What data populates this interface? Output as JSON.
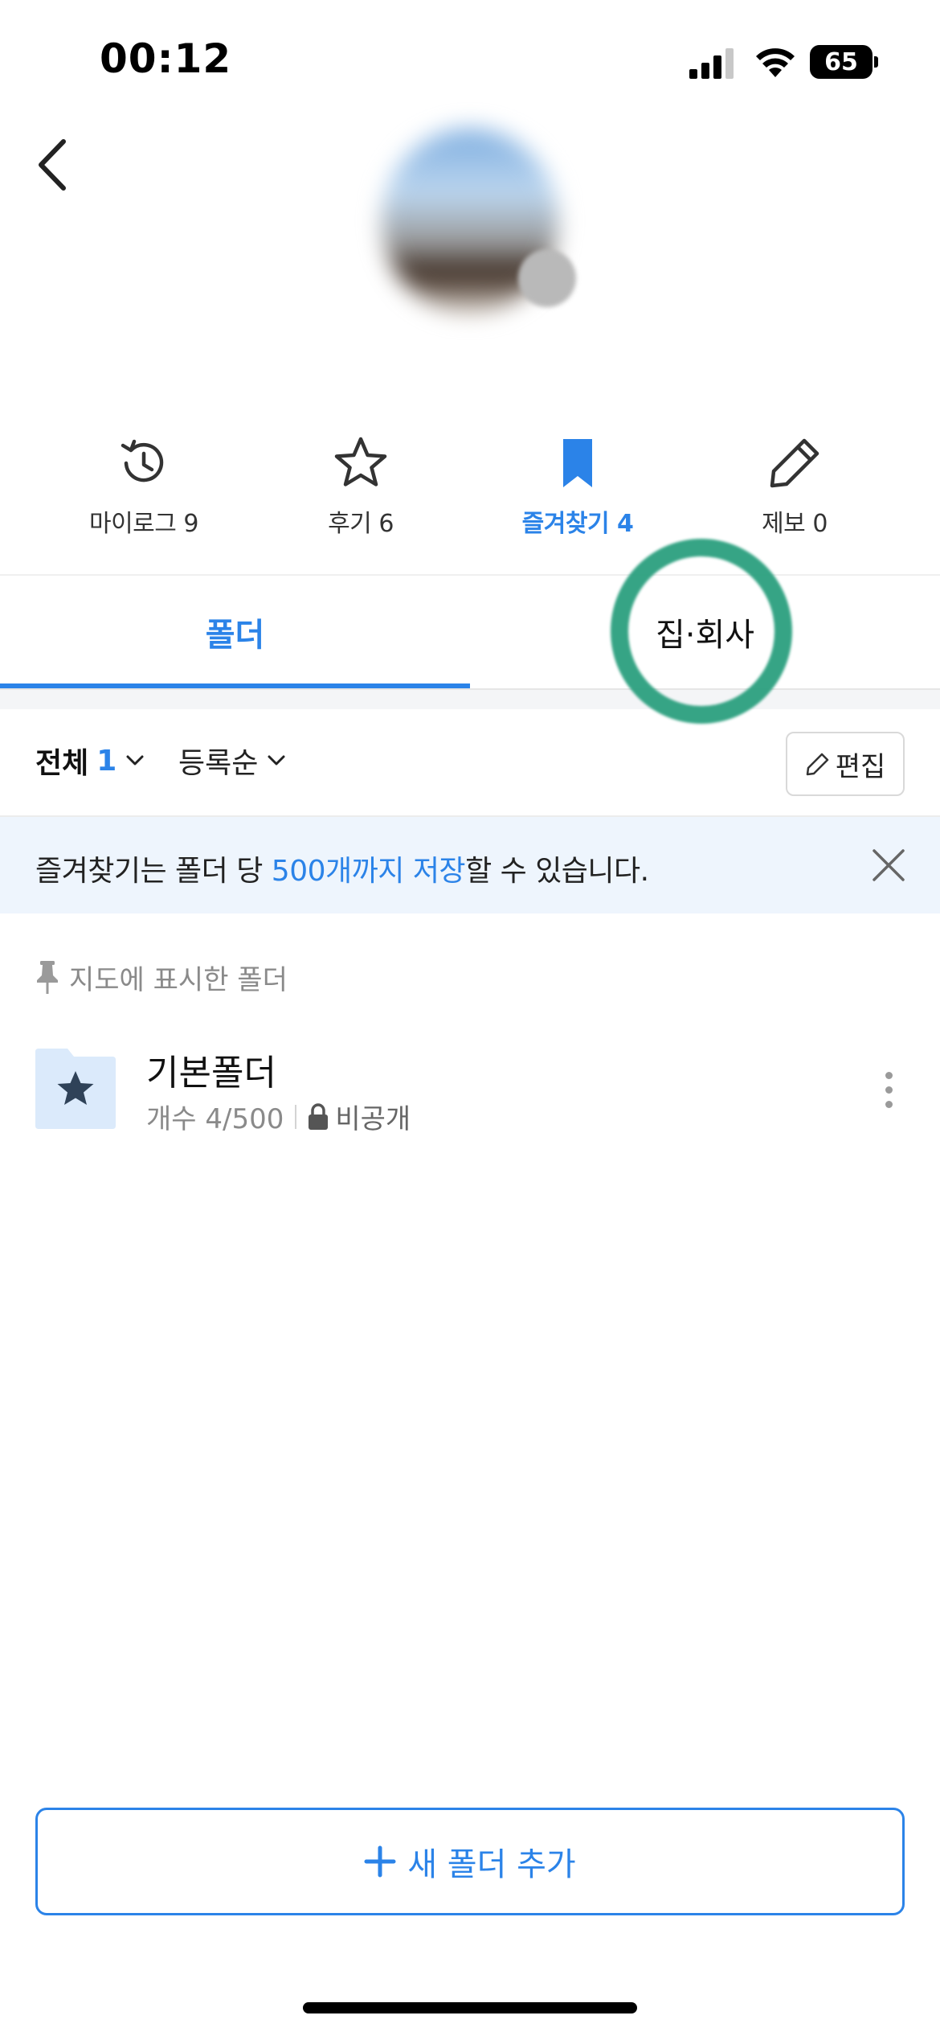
{
  "status_bar": {
    "time": "00:12",
    "battery": "65",
    "icons": [
      "signal-icon",
      "wifi-icon",
      "battery-icon"
    ]
  },
  "header": {
    "back_icon": "chevron-left-icon",
    "avatar": "blurred-profile-avatar"
  },
  "stats": [
    {
      "icon": "history-icon",
      "label": "마이로그 9"
    },
    {
      "icon": "star-icon",
      "label": "후기 6"
    },
    {
      "icon": "bookmark-icon",
      "label": "즐겨찾기 4",
      "active": true
    },
    {
      "icon": "pencil-icon",
      "label": "제보 0"
    }
  ],
  "tabs": [
    {
      "label": "폴더",
      "active": true
    },
    {
      "label": "집·회사",
      "active": false
    }
  ],
  "filter": {
    "all_label": "전체",
    "all_count": "1",
    "sort_label": "등록순",
    "edit_label": "편집"
  },
  "notice": {
    "prefix": "즐겨찾기는 폴더 당 ",
    "highlight": "500개까지 저장",
    "suffix": "할 수 있습니다."
  },
  "section": {
    "label": "지도에 표시한 폴더",
    "icon": "pin-icon"
  },
  "folders": [
    {
      "name": "기본폴더",
      "count": "개수 4/500",
      "visibility": "비공개",
      "icon": "star-folder-icon"
    }
  ],
  "add_folder": {
    "label": "새 폴더 추가",
    "icon": "plus-icon"
  },
  "colors": {
    "accent": "#2b83e8",
    "annotation": "#2ca07f",
    "notice_bg": "#eef5fd"
  }
}
